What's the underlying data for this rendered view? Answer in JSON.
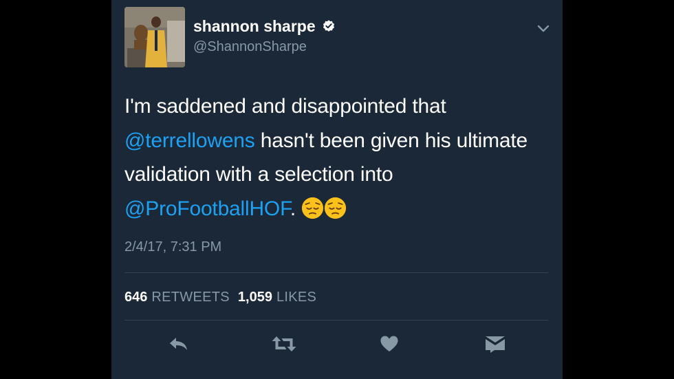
{
  "user": {
    "display_name": "shannon sharpe",
    "handle": "@ShannonSharpe",
    "verified": true
  },
  "tweet": {
    "text_part1": "I'm saddened and disappointed that ",
    "mention1": "@terrellowens",
    "text_part2": " hasn't been given his ultimate validation with a selection into ",
    "mention2": "@ProFootballHOF",
    "text_part3": ". ",
    "emojis": [
      "pensive-face-emoji",
      "pensive-face-emoji"
    ]
  },
  "timestamp": "2/4/17, 7:31 PM",
  "stats": {
    "retweets_count": "646",
    "retweets_label": "RETWEETS",
    "likes_count": "1,059",
    "likes_label": "LIKES"
  },
  "actions": [
    "reply-icon",
    "retweet-icon",
    "like-icon",
    "direct-message-icon"
  ],
  "colors": {
    "background": "#1b2838",
    "mention": "#1da1f2",
    "secondary_text": "#8899a6",
    "divider": "#38444d"
  }
}
